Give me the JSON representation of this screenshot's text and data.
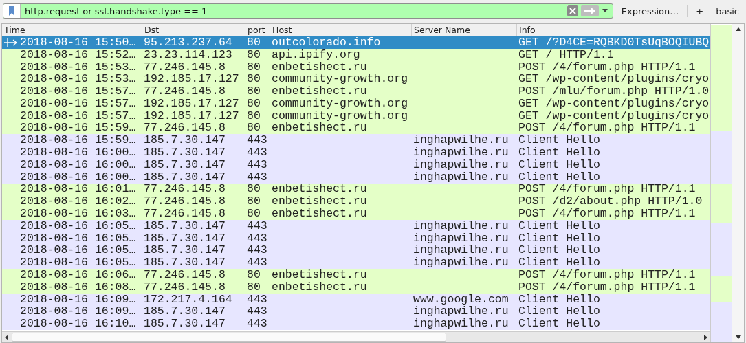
{
  "filter_bar": {
    "value": "http.request or ssl.handshake.type == 1",
    "buttons": [
      "Expression…",
      "+",
      "basic"
    ]
  },
  "table": {
    "columns": [
      "Time",
      "Dst",
      "port",
      "Host",
      "Server Name",
      "Info"
    ],
    "rows": [
      {
        "time": "2018-08-16 15:50…",
        "dst": "95.213.237.64",
        "port": "80",
        "host": "outcolorado.info",
        "info": "GET /?D4CE=RQBKD0TsUqBOQIUBQ",
        "color": "#e4ffc7",
        "selected": true
      },
      {
        "time": "2018-08-16 15:52…",
        "dst": "23.23.114.123",
        "port": "80",
        "host": "api.ipify.org",
        "info": "GET / HTTP/1.1",
        "color": "#e4ffc7",
        "selected": false
      },
      {
        "time": "2018-08-16 15:53…",
        "dst": "77.246.145.8",
        "port": "80",
        "host": "enbetishect.ru",
        "info": "POST /4/forum.php HTTP/1.1",
        "color": "#e4ffc7",
        "selected": false
      },
      {
        "time": "2018-08-16 15:53…",
        "dst": "192.185.17.127",
        "port": "80",
        "host": "community-growth.org",
        "info": "GET /wp-content/plugins/cryo",
        "color": "#e4ffc7",
        "selected": false
      },
      {
        "time": "2018-08-16 15:57…",
        "dst": "77.246.145.8",
        "port": "80",
        "host": "enbetishect.ru",
        "info": "POST /mlu/forum.php HTTP/1.0",
        "color": "#e4ffc7",
        "selected": false
      },
      {
        "time": "2018-08-16 15:57…",
        "dst": "192.185.17.127",
        "port": "80",
        "host": "community-growth.org",
        "info": "GET /wp-content/plugins/cryo",
        "color": "#e4ffc7",
        "selected": false
      },
      {
        "time": "2018-08-16 15:57…",
        "dst": "192.185.17.127",
        "port": "80",
        "host": "community-growth.org",
        "info": "GET /wp-content/plugins/cryo",
        "color": "#e4ffc7",
        "selected": false
      },
      {
        "time": "2018-08-16 15:59…",
        "dst": "77.246.145.8",
        "port": "80",
        "host": "enbetishect.ru",
        "info": "POST /4/forum.php HTTP/1.1",
        "color": "#e4ffc7",
        "selected": false
      },
      {
        "time": "2018-08-16 15:59…",
        "dst": "185.7.30.147",
        "port": "443",
        "server_name": "inghapwilhe.ru",
        "info": "Client Hello",
        "color": "#e7e6ff",
        "selected": false
      },
      {
        "time": "2018-08-16 16:00…",
        "dst": "185.7.30.147",
        "port": "443",
        "server_name": "inghapwilhe.ru",
        "info": "Client Hello",
        "color": "#e7e6ff",
        "selected": false
      },
      {
        "time": "2018-08-16 16:00…",
        "dst": "185.7.30.147",
        "port": "443",
        "server_name": "inghapwilhe.ru",
        "info": "Client Hello",
        "color": "#e7e6ff",
        "selected": false
      },
      {
        "time": "2018-08-16 16:00…",
        "dst": "185.7.30.147",
        "port": "443",
        "server_name": "inghapwilhe.ru",
        "info": "Client Hello",
        "color": "#e7e6ff",
        "selected": false
      },
      {
        "time": "2018-08-16 16:01…",
        "dst": "77.246.145.8",
        "port": "80",
        "host": "enbetishect.ru",
        "info": "POST /4/forum.php HTTP/1.1",
        "color": "#e4ffc7",
        "selected": false
      },
      {
        "time": "2018-08-16 16:02…",
        "dst": "77.246.145.8",
        "port": "80",
        "host": "enbetishect.ru",
        "info": "POST /d2/about.php HTTP/1.0",
        "color": "#e4ffc7",
        "selected": false
      },
      {
        "time": "2018-08-16 16:03…",
        "dst": "77.246.145.8",
        "port": "80",
        "host": "enbetishect.ru",
        "info": "POST /4/forum.php HTTP/1.1",
        "color": "#e4ffc7",
        "selected": false
      },
      {
        "time": "2018-08-16 16:05…",
        "dst": "185.7.30.147",
        "port": "443",
        "server_name": "inghapwilhe.ru",
        "info": "Client Hello",
        "color": "#e7e6ff",
        "selected": false
      },
      {
        "time": "2018-08-16 16:05…",
        "dst": "185.7.30.147",
        "port": "443",
        "server_name": "inghapwilhe.ru",
        "info": "Client Hello",
        "color": "#e7e6ff",
        "selected": false
      },
      {
        "time": "2018-08-16 16:05…",
        "dst": "185.7.30.147",
        "port": "443",
        "server_name": "inghapwilhe.ru",
        "info": "Client Hello",
        "color": "#e7e6ff",
        "selected": false
      },
      {
        "time": "2018-08-16 16:05…",
        "dst": "185.7.30.147",
        "port": "443",
        "server_name": "inghapwilhe.ru",
        "info": "Client Hello",
        "color": "#e7e6ff",
        "selected": false
      },
      {
        "time": "2018-08-16 16:06…",
        "dst": "77.246.145.8",
        "port": "80",
        "host": "enbetishect.ru",
        "info": "POST /4/forum.php HTTP/1.1",
        "color": "#e4ffc7",
        "selected": false
      },
      {
        "time": "2018-08-16 16:08…",
        "dst": "77.246.145.8",
        "port": "80",
        "host": "enbetishect.ru",
        "info": "POST /4/forum.php HTTP/1.1",
        "color": "#e4ffc7",
        "selected": false
      },
      {
        "time": "2018-08-16 16:09…",
        "dst": "172.217.4.164",
        "port": "443",
        "server_name": "www.google.com",
        "info": "Client Hello",
        "color": "#e7e6ff",
        "selected": false
      },
      {
        "time": "2018-08-16 16:09…",
        "dst": "185.7.30.147",
        "port": "443",
        "server_name": "inghapwilhe.ru",
        "info": "Client Hello",
        "color": "#e7e6ff",
        "selected": false
      },
      {
        "time": "2018-08-16 16:10…",
        "dst": "185.7.30.147",
        "port": "443",
        "server_name": "inghapwilhe.ru",
        "info": "Client Hello",
        "color": "#e7e6ff",
        "selected": false
      }
    ]
  }
}
